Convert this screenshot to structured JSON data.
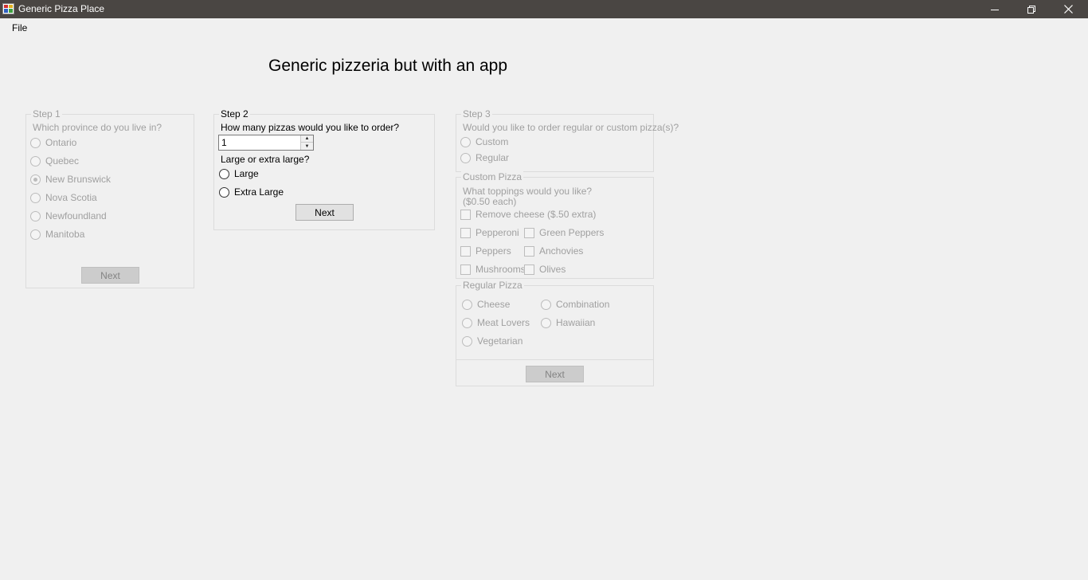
{
  "window": {
    "title": "Generic Pizza Place",
    "minimize_icon": "minimize-icon",
    "restore_icon": "restore-icon",
    "close_icon": "close-icon"
  },
  "menu": {
    "file": "File"
  },
  "heading": "Generic pizzeria but with an app",
  "step1": {
    "label": "Step 1",
    "question": "Which province do you live in?",
    "options": [
      "Ontario",
      "Quebec",
      "New Brunswick",
      "Nova Scotia",
      "Newfoundland",
      "Manitoba"
    ],
    "selected": "New Brunswick",
    "next": "Next"
  },
  "step2": {
    "label": "Step 2",
    "question": "How many pizzas would you like to order?",
    "quantity": "1",
    "size_question": "Large or extra large?",
    "sizes": [
      "Large",
      "Extra Large"
    ],
    "next": "Next"
  },
  "step3": {
    "label": "Step 3",
    "question": "Would you like to order regular or custom pizza(s)?",
    "options": [
      "Custom",
      "Regular"
    ]
  },
  "custom": {
    "label": "Custom Pizza",
    "question_line1": "What toppings would you like?",
    "question_line2": "($0.50 each)",
    "remove_cheese": "Remove cheese ($.50 extra)",
    "toppings_col1": [
      "Pepperoni",
      "Peppers",
      "Mushrooms"
    ],
    "toppings_col2": [
      "Green Peppers",
      "Anchovies",
      "Olives"
    ]
  },
  "regular": {
    "label": "Regular Pizza",
    "col1": [
      "Cheese",
      "Meat Lovers",
      "Vegetarian"
    ],
    "col2": [
      "Combination",
      "Hawaiian"
    ],
    "next": "Next"
  }
}
